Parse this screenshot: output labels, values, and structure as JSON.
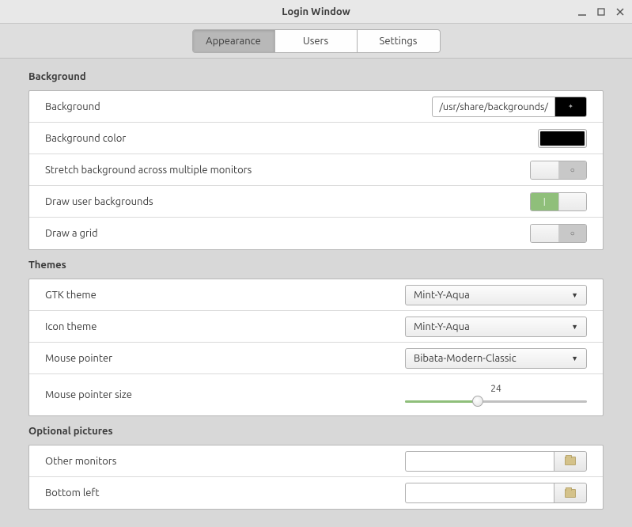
{
  "window": {
    "title": "Login Window"
  },
  "tabs": {
    "appearance": "Appearance",
    "users": "Users",
    "settings": "Settings"
  },
  "background": {
    "header": "Background",
    "background_label": "Background",
    "background_path": "/usr/share/backgrounds/",
    "background_color_label": "Background color",
    "background_color": "#000000",
    "stretch_label": "Stretch background across multiple monitors",
    "stretch_enabled": false,
    "draw_user_bg_label": "Draw user backgrounds",
    "draw_user_bg_enabled": true,
    "draw_grid_label": "Draw a grid",
    "draw_grid_enabled": false
  },
  "themes": {
    "header": "Themes",
    "gtk_label": "GTK theme",
    "gtk_value": "Mint-Y-Aqua",
    "icon_label": "Icon theme",
    "icon_value": "Mint-Y-Aqua",
    "pointer_label": "Mouse pointer",
    "pointer_value": "Bibata-Modern-Classic",
    "pointer_size_label": "Mouse pointer size",
    "pointer_size_value": "24",
    "pointer_size_percent": 40
  },
  "optional_pictures": {
    "header": "Optional pictures",
    "other_monitors_label": "Other monitors",
    "bottom_left_label": "Bottom left"
  },
  "switch_off_symbol": "○",
  "switch_on_symbol": "|"
}
